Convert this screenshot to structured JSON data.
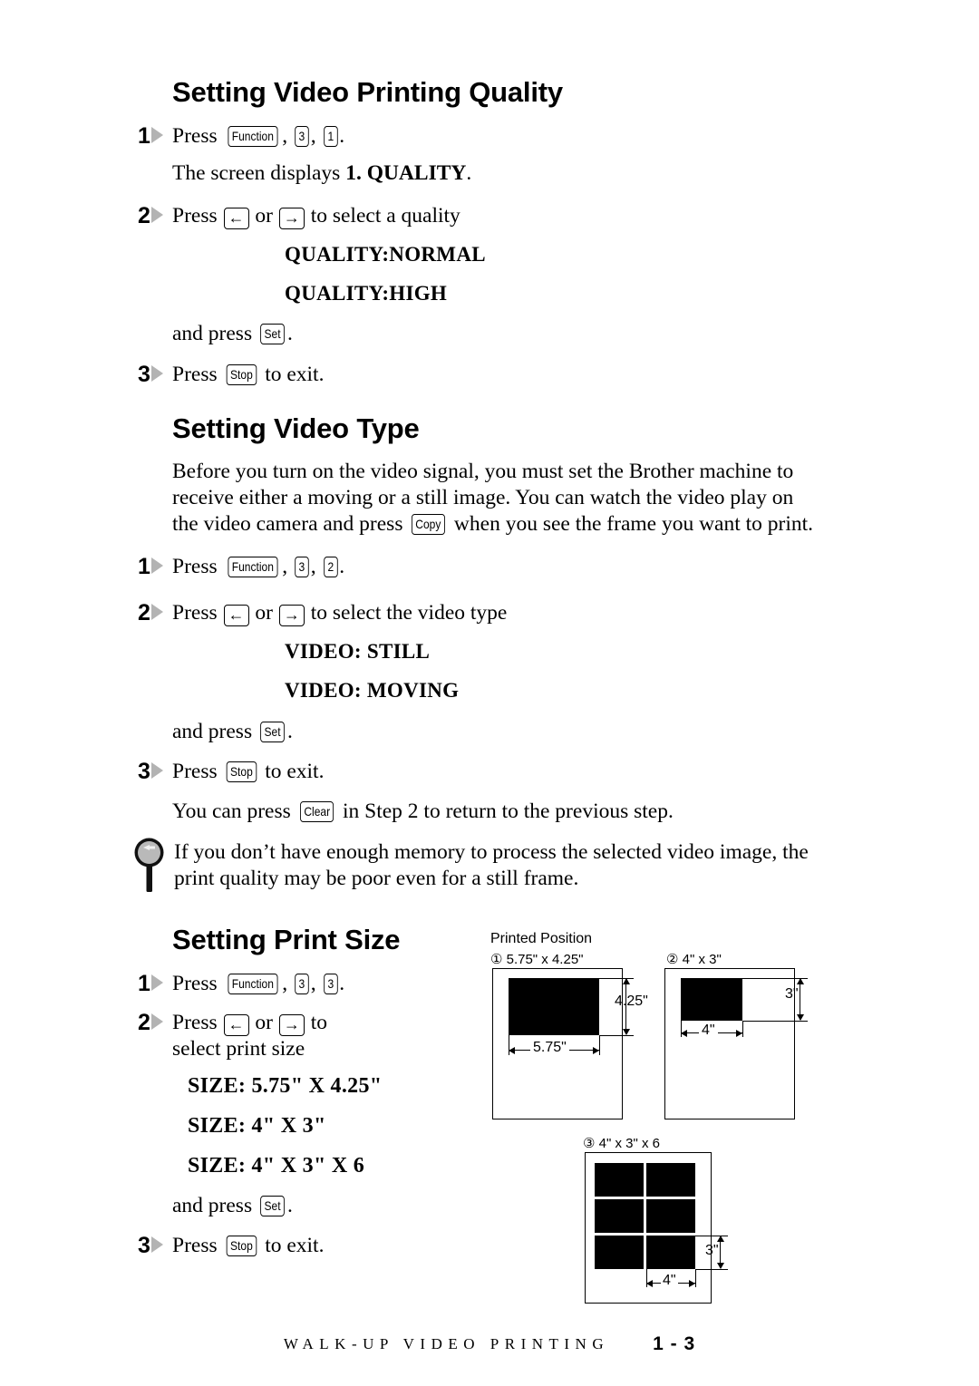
{
  "sections": [
    {
      "heading": "Setting Video Printing Quality",
      "steps": [
        {
          "num": "1",
          "pre": "Press ",
          "keys": [
            "Function",
            "3",
            "1"
          ],
          "post": "."
        },
        {
          "num": "",
          "text_before": "The screen displays ",
          "bold": "1. QUALITY",
          "text_after": "."
        },
        {
          "num": "2",
          "pre": "Press ",
          "arrows": [
            "←",
            "→"
          ],
          "mid": " or ",
          "post": " to select a quality"
        }
      ],
      "options": [
        "QUALITY:NORMAL",
        "QUALITY:HIGH"
      ],
      "and_press": "and press ",
      "set_key": "Set",
      "and_press_end": ".",
      "exit_num": "3",
      "exit_pre": "Press ",
      "exit_key": "Stop",
      "exit_post": " to exit."
    },
    {
      "heading": "Setting Video Type",
      "intro_1": "Before you turn on the video signal, you must set the Brother machine to",
      "intro_2": "receive either a moving or a still image. You can watch the video play on",
      "intro_3a": "the video camera and press ",
      "intro_copy_key": "Copy",
      "intro_3b": " when you see the frame you want to print.",
      "step1_pre": "Press ",
      "step1_keys": [
        "Function",
        "3",
        "2"
      ],
      "step1_post": ".",
      "step2_pre": "Press ",
      "step2_mid": " or ",
      "step2_post": " to select the video type",
      "options": [
        "VIDEO: STILL",
        "VIDEO: MOVING"
      ],
      "clear_pre": "You can press ",
      "clear_key": "Clear",
      "clear_post": " in Step 2 to return to the previous step."
    },
    {
      "heading": "Setting Print Size",
      "step1_pre": "Press ",
      "step1_keys": [
        "Function",
        "3",
        "3"
      ],
      "step1_post": ".",
      "step2_pre": "Press ",
      "step2_mid": " or ",
      "step2_post": " to",
      "step2_line2": "select print size",
      "options": [
        "SIZE: 5.75\" X 4.25\"",
        "SIZE: 4\" X 3\"",
        "SIZE: 4\" X 3\" X 6"
      ]
    }
  ],
  "note": {
    "line1": "If you don’t have enough memory to process the selected video image, the",
    "line2": "print quality may be poor even for a still frame."
  },
  "common": {
    "and_press": "and press ",
    "set_key": "Set",
    "period": ".",
    "press": "Press ",
    "stop_key": "Stop",
    "to_exit": " to exit.",
    "step_1": "1",
    "step_2": "2",
    "step_3": "3",
    "arrow_left": "←",
    "arrow_right": "→"
  },
  "diagram": {
    "title": "Printed Position",
    "fig1": {
      "label": "① 5.75\" x 4.25\"",
      "width_dim": "5.75\"",
      "height_dim": "4.25\""
    },
    "fig2": {
      "label": "② 4\" x 3\"",
      "width_dim": "4\"",
      "height_dim": "3\""
    },
    "fig3": {
      "label": "③ 4\" x 3\" x 6",
      "width_dim": "4\"",
      "height_dim": "3\""
    }
  },
  "footer": {
    "title": "WALK-UP VIDEO PRINTING",
    "page": "1 - 3"
  }
}
